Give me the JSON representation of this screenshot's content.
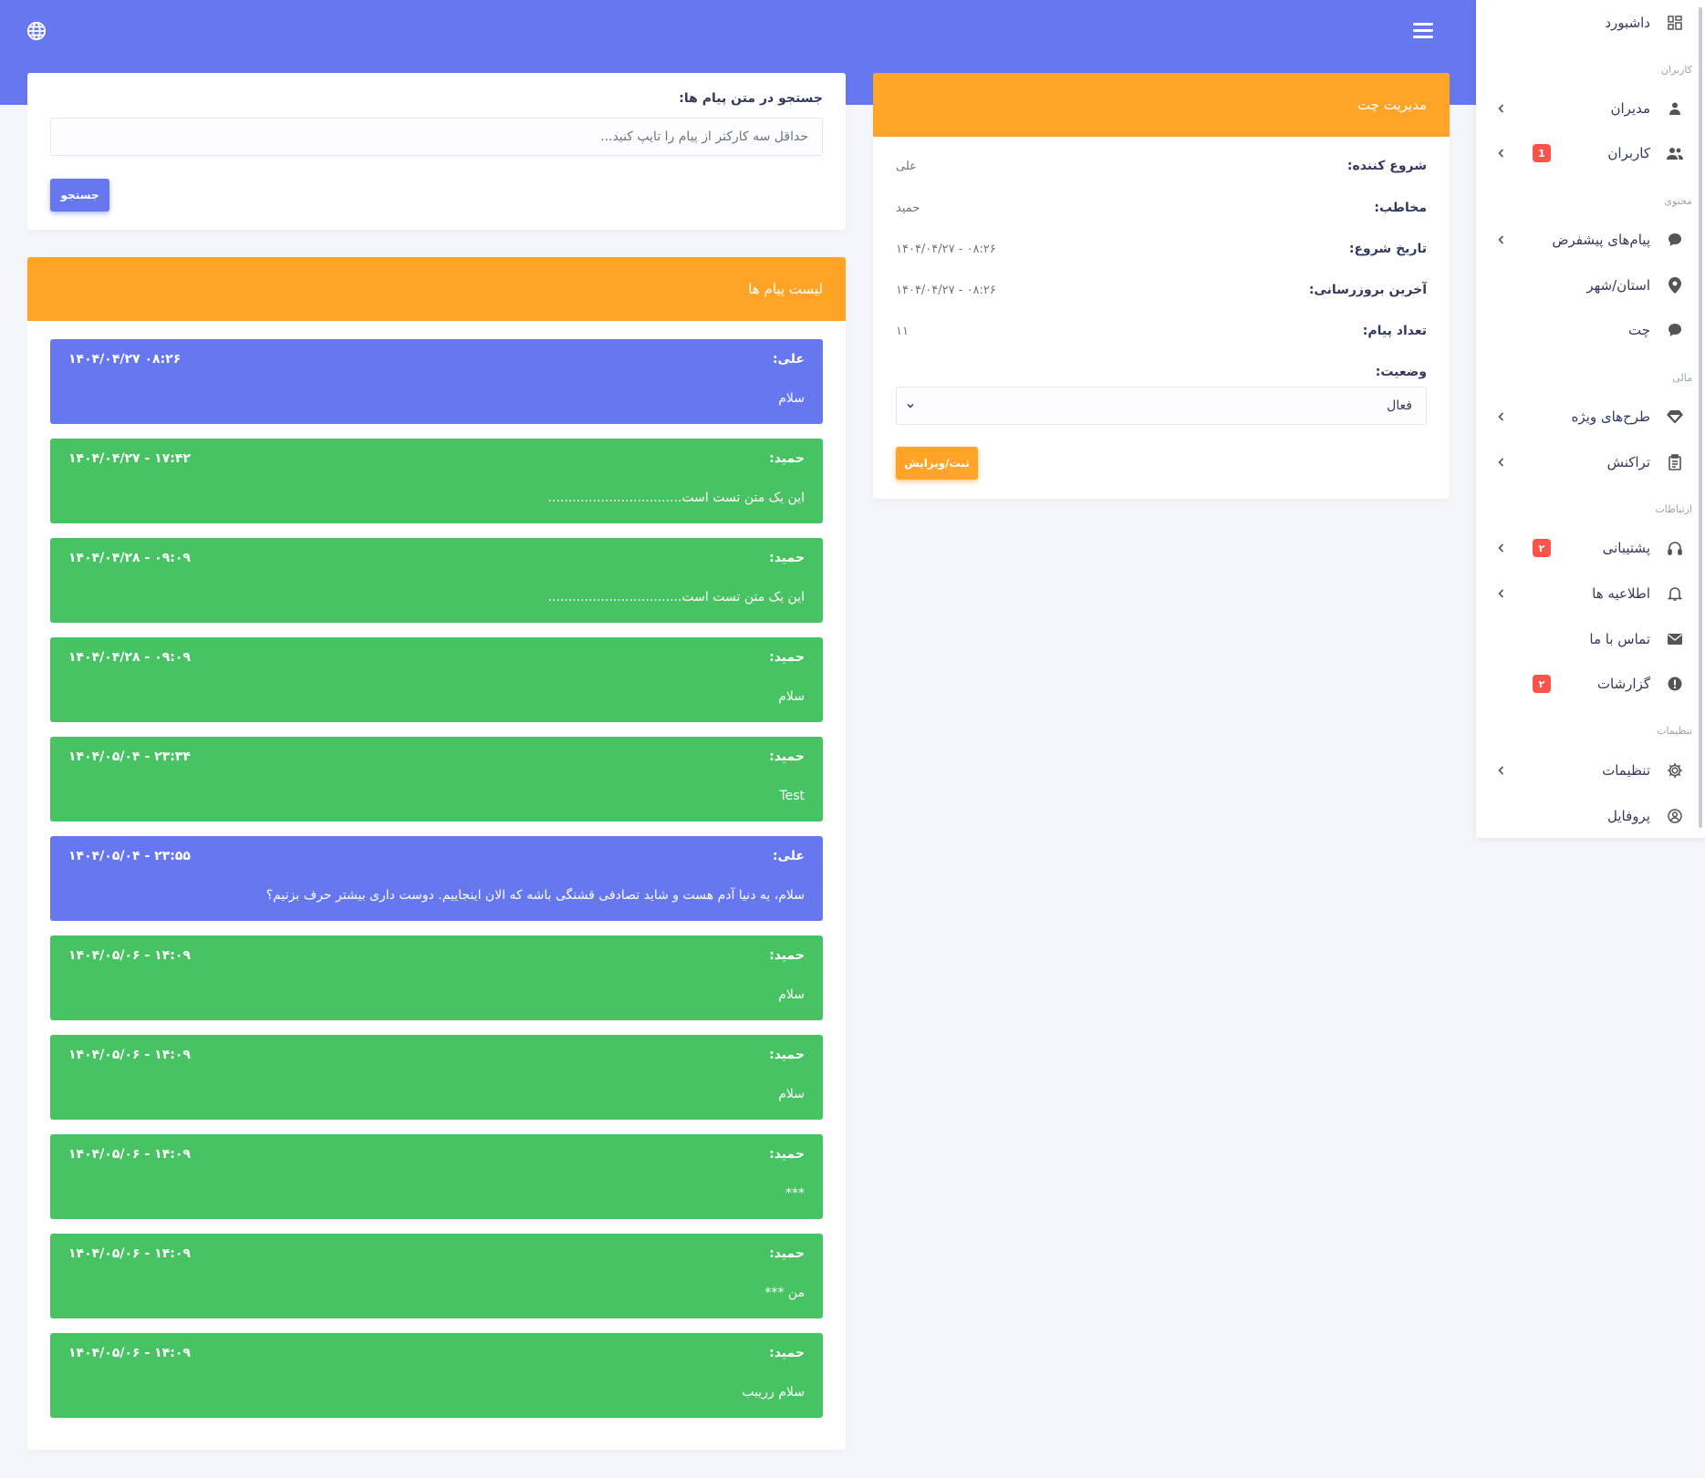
{
  "sidebar": {
    "dashboard": "داشبورد",
    "heading_users": "کاربران",
    "admins": "مدیران",
    "users": "کاربران",
    "users_badge": "1",
    "heading_content": "محتوی",
    "default_messages": "پیام‌های پیشفرض",
    "province_city": "استان/شهر",
    "chat": "چت",
    "heading_finance": "مالی",
    "special_plans": "طرح‌های ویژه",
    "transaction": "تراکنش",
    "heading_communications": "ارتباطات",
    "support": "پشتیبانی",
    "support_badge": "۲",
    "announcements": "اطلاعیه ها",
    "contact_us": "تماس با ما",
    "reports": "گزارشات",
    "reports_badge": "۲",
    "heading_settings": "تنظیمات",
    "settings": "تنظیمات",
    "profile": "پروفایل"
  },
  "search": {
    "label": "جستجو در متن پیام ها:",
    "placeholder": "حداقل سه کارکتر از پیام را تایپ کنید...",
    "button": "جستجو"
  },
  "messages_card": {
    "title": "لیست پیام ها"
  },
  "messages": [
    {
      "sender": "علی:",
      "date": "۱۴۰۴/۰۴/۲۷ ۰۸:۲۶",
      "text": "سلام",
      "color": "blue"
    },
    {
      "sender": "حمید:",
      "date": "۱۴۰۴/۰۴/۲۷ - ۱۷:۴۲",
      "text": "این یک متن تست است.................................",
      "color": "green"
    },
    {
      "sender": "حمید:",
      "date": "۱۴۰۴/۰۴/۲۸ - ۰۹:۰۹",
      "text": "این یک متن تست است.................................",
      "color": "green"
    },
    {
      "sender": "حمید:",
      "date": "۱۴۰۴/۰۴/۲۸ - ۰۹:۰۹",
      "text": "سلام",
      "color": "green"
    },
    {
      "sender": "حمید:",
      "date": "۱۴۰۴/۰۵/۰۴ - ۲۳:۳۴",
      "text": "Test",
      "color": "green"
    },
    {
      "sender": "علی:",
      "date": "۱۴۰۴/۰۵/۰۴ - ۲۳:۵۵",
      "text": "سلام، یه دنیا آدم هست و شاید تصادفی قشنگی باشه که الان اینجاییم. دوست داری بیشتر حرف بزنیم؟",
      "color": "blue"
    },
    {
      "sender": "حمید:",
      "date": "۱۴۰۴/۰۵/۰۶ - ۱۴:۰۹",
      "text": "سلام",
      "color": "green"
    },
    {
      "sender": "حمید:",
      "date": "۱۴۰۴/۰۵/۰۶ - ۱۴:۰۹",
      "text": "سلام",
      "color": "green"
    },
    {
      "sender": "حمید:",
      "date": "۱۴۰۴/۰۵/۰۶ - ۱۴:۰۹",
      "text": "***",
      "color": "green"
    },
    {
      "sender": "حمید:",
      "date": "۱۴۰۴/۰۵/۰۶ - ۱۴:۰۹",
      "text": "من ***",
      "color": "green"
    },
    {
      "sender": "حمید:",
      "date": "۱۴۰۴/۰۵/۰۶ - ۱۴:۰۹",
      "text": "سلام رریبب",
      "color": "green"
    }
  ],
  "chat_card": {
    "title": "مدیریت چت",
    "starter_label": "شروع کننده:",
    "starter_value": "علی",
    "recipient_label": "مخاطب:",
    "recipient_value": "حمید",
    "start_date_label": "تاریخ شروع:",
    "start_date_value": "۱۴۰۴/۰۴/۲۷ - ۰۸:۲۶",
    "last_update_label": "آخرین بروزرسانی:",
    "last_update_value": "۱۴۰۴/۰۴/۲۷ - ۰۸:۲۶",
    "message_count_label": "تعداد پیام:",
    "message_count_value": "۱۱",
    "status_label": "وضعیت:",
    "status_value": "فعال",
    "submit_button": "ثبت/ویرایش"
  },
  "colors": {
    "primary": "#6777ef",
    "warning": "#ffa426",
    "success": "#47c363",
    "danger": "#fc544b"
  }
}
